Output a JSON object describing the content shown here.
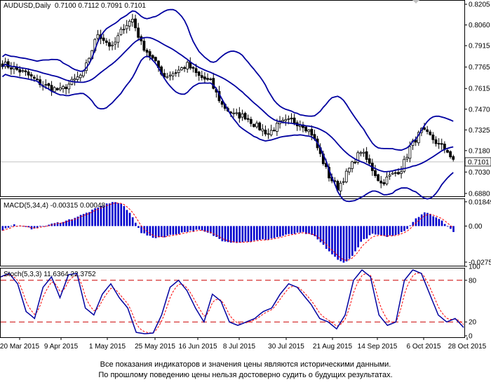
{
  "header": {
    "symbol": "AUDUSD,Daily",
    "ohlc": "0.7100 0.7112 0.7091 0.7101",
    "macd": "MACD(5,34,4) -0.00315 0.00048",
    "stoch": "Stoch(5,3,3) 11.6364 22.3752"
  },
  "disclaimer": {
    "line1": "Все показания индикаторов и значения цены являются историческими данными.",
    "line2": "По прошлому поведению цены нельзя достоверно судить о будущих результатах."
  },
  "colors": {
    "candle": "#000000",
    "bollinger": "#0000a0",
    "macd_hist": "#0000cc",
    "macd_signal": "#ff0000",
    "stoch_main": "#0000a0",
    "stoch_signal": "#ff0000",
    "stoch_levels": "#cc0000",
    "current_price": "#c0c0c0"
  },
  "chart_data": [
    {
      "type": "candlestick",
      "title": "AUDUSD,Daily",
      "y_ticks": [
        "0.8205",
        "0.8060",
        "0.7915",
        "0.7765",
        "0.7615",
        "0.7470",
        "0.7325",
        "0.7180",
        "0.7030",
        "0.6880"
      ],
      "ylim": [
        0.686,
        0.8225
      ],
      "current_price": "0.7101",
      "x_ticks": [
        "20 Mar 2015",
        "9 Apr 2015",
        "1 May 2015",
        "25 May 2015",
        "16 Jun 2015",
        "8 Jul 2015",
        "30 Jul 2015",
        "21 Aug 2015",
        "14 Sep 2015",
        "6 Oct 2015",
        "28 Oct 2015"
      ],
      "overlay": "Bollinger Bands",
      "close_keypoints": [
        [
          0,
          0.779
        ],
        [
          8,
          0.772
        ],
        [
          14,
          0.764
        ],
        [
          20,
          0.76
        ],
        [
          28,
          0.772
        ],
        [
          33,
          0.8
        ],
        [
          38,
          0.79
        ],
        [
          42,
          0.805
        ],
        [
          45,
          0.81
        ],
        [
          48,
          0.793
        ],
        [
          52,
          0.782
        ],
        [
          56,
          0.77
        ],
        [
          60,
          0.773
        ],
        [
          64,
          0.778
        ],
        [
          68,
          0.77
        ],
        [
          72,
          0.766
        ],
        [
          76,
          0.75
        ],
        [
          80,
          0.743
        ],
        [
          84,
          0.742
        ],
        [
          88,
          0.735
        ],
        [
          92,
          0.73
        ],
        [
          96,
          0.737
        ],
        [
          100,
          0.739
        ],
        [
          104,
          0.736
        ],
        [
          107,
          0.73
        ],
        [
          110,
          0.715
        ],
        [
          113,
          0.7
        ],
        [
          116,
          0.692
        ],
        [
          120,
          0.705
        ],
        [
          124,
          0.718
        ],
        [
          128,
          0.705
        ],
        [
          131,
          0.695
        ],
        [
          134,
          0.7
        ],
        [
          138,
          0.705
        ],
        [
          141,
          0.72
        ],
        [
          145,
          0.732
        ],
        [
          148,
          0.728
        ],
        [
          151,
          0.722
        ],
        [
          154,
          0.718
        ],
        [
          156,
          0.7101
        ]
      ]
    },
    {
      "type": "bar",
      "title": "MACD(5,34,4)",
      "y_ticks": [
        "0.01849",
        "0.00",
        "-0.0275"
      ],
      "ylim": [
        -0.0297,
        0.02
      ],
      "values_keypoints": [
        [
          0,
          -0.003
        ],
        [
          4,
          0.001
        ],
        [
          10,
          -0.002
        ],
        [
          16,
          0.001
        ],
        [
          22,
          0.004
        ],
        [
          28,
          0.009
        ],
        [
          34,
          0.015
        ],
        [
          38,
          0.0185
        ],
        [
          41,
          0.017
        ],
        [
          44,
          0.01
        ],
        [
          46,
          0.003
        ],
        [
          48,
          -0.005
        ],
        [
          52,
          -0.009
        ],
        [
          56,
          -0.008
        ],
        [
          60,
          -0.006
        ],
        [
          64,
          -0.004
        ],
        [
          68,
          -0.003
        ],
        [
          72,
          -0.006
        ],
        [
          76,
          -0.011
        ],
        [
          80,
          -0.0125
        ],
        [
          84,
          -0.012
        ],
        [
          88,
          -0.011
        ],
        [
          92,
          -0.01
        ],
        [
          96,
          -0.008
        ],
        [
          100,
          -0.006
        ],
        [
          104,
          -0.005
        ],
        [
          108,
          -0.008
        ],
        [
          112,
          -0.017
        ],
        [
          116,
          -0.026
        ],
        [
          118,
          -0.028
        ],
        [
          121,
          -0.023
        ],
        [
          124,
          -0.012
        ],
        [
          128,
          -0.006
        ],
        [
          132,
          -0.008
        ],
        [
          136,
          -0.007
        ],
        [
          140,
          -0.002
        ],
        [
          143,
          0.006
        ],
        [
          146,
          0.0105
        ],
        [
          149,
          0.008
        ],
        [
          152,
          0.004
        ],
        [
          156,
          -0.004
        ]
      ]
    },
    {
      "type": "line",
      "title": "Stoch(5,3,3)",
      "y_ticks": [
        "100",
        "80",
        "20",
        "0"
      ],
      "ylim": [
        0,
        100
      ],
      "levels": [
        80,
        20
      ],
      "main_keypoints": [
        [
          0,
          85
        ],
        [
          3,
          90
        ],
        [
          6,
          75
        ],
        [
          9,
          35
        ],
        [
          12,
          25
        ],
        [
          15,
          70
        ],
        [
          18,
          85
        ],
        [
          21,
          55
        ],
        [
          24,
          88
        ],
        [
          27,
          90
        ],
        [
          30,
          40
        ],
        [
          33,
          30
        ],
        [
          36,
          60
        ],
        [
          39,
          75
        ],
        [
          42,
          55
        ],
        [
          45,
          40
        ],
        [
          48,
          5
        ],
        [
          51,
          3
        ],
        [
          54,
          4
        ],
        [
          57,
          30
        ],
        [
          60,
          70
        ],
        [
          63,
          80
        ],
        [
          66,
          65
        ],
        [
          69,
          40
        ],
        [
          72,
          20
        ],
        [
          75,
          60
        ],
        [
          78,
          50
        ],
        [
          81,
          20
        ],
        [
          84,
          15
        ],
        [
          87,
          20
        ],
        [
          90,
          25
        ],
        [
          93,
          35
        ],
        [
          96,
          40
        ],
        [
          99,
          60
        ],
        [
          102,
          75
        ],
        [
          105,
          70
        ],
        [
          108,
          55
        ],
        [
          110,
          45
        ],
        [
          113,
          25
        ],
        [
          116,
          20
        ],
        [
          119,
          10
        ],
        [
          122,
          30
        ],
        [
          125,
          80
        ],
        [
          128,
          95
        ],
        [
          131,
          85
        ],
        [
          134,
          30
        ],
        [
          137,
          15
        ],
        [
          140,
          20
        ],
        [
          143,
          80
        ],
        [
          146,
          95
        ],
        [
          149,
          90
        ],
        [
          152,
          60
        ],
        [
          155,
          30
        ],
        [
          158,
          20
        ],
        [
          161,
          25
        ],
        [
          164,
          12
        ]
      ]
    }
  ]
}
